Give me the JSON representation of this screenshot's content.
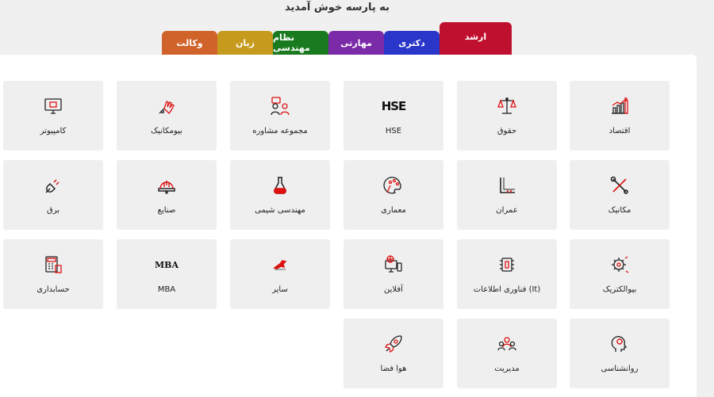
{
  "welcome": "به پارسه خوش آمدید",
  "tabs": [
    {
      "label": "ارشد",
      "color": "#c0102f",
      "active": true
    },
    {
      "label": "دکتری",
      "color": "#2a35c9"
    },
    {
      "label": "مهارتی",
      "color": "#7b2aa8"
    },
    {
      "label": "نظام مهندسی",
      "color": "#1a7a1f"
    },
    {
      "label": "زبان",
      "color": "#c69a1c"
    },
    {
      "label": "وکالت",
      "color": "#d0632a"
    }
  ],
  "cards": [
    {
      "label": "اقتصاد",
      "icon": "chart-growth-icon"
    },
    {
      "label": "حقوق",
      "icon": "scales-icon"
    },
    {
      "label": "HSE",
      "icon": "hse-logo-icon",
      "icon_text": "HSE"
    },
    {
      "label": "مجموعه مشاوره",
      "icon": "consultation-icon"
    },
    {
      "label": "بیومکانیک",
      "icon": "robot-hand-icon"
    },
    {
      "label": "کامپیوتر",
      "icon": "computer-monitor-icon"
    },
    {
      "label": "مکانیک",
      "icon": "tools-icon"
    },
    {
      "label": "عمران",
      "icon": "ruler-square-icon"
    },
    {
      "label": "معماری",
      "icon": "palette-icon"
    },
    {
      "label": "مهندسی شیمی",
      "icon": "flask-icon"
    },
    {
      "label": "صنایع",
      "icon": "hard-hat-icon"
    },
    {
      "label": "برق",
      "icon": "plug-icon"
    },
    {
      "label": "بیوالکتریک",
      "icon": "bio-gear-icon"
    },
    {
      "label": "فناوری اطلاعات (It)",
      "icon": "chip-icon"
    },
    {
      "label": "آفلاین",
      "icon": "offline-devices-icon"
    },
    {
      "label": "سایر",
      "icon": "bird-logo-icon"
    },
    {
      "label": "MBA",
      "icon": "mba-logo-icon",
      "icon_text": "MBA"
    },
    {
      "label": "حسابداری",
      "icon": "calculator-icon"
    },
    {
      "label": "روانشناسی",
      "icon": "head-icon"
    },
    {
      "label": "مدیریت",
      "icon": "team-icon"
    },
    {
      "label": "هوا فضا",
      "icon": "rocket-icon"
    }
  ]
}
